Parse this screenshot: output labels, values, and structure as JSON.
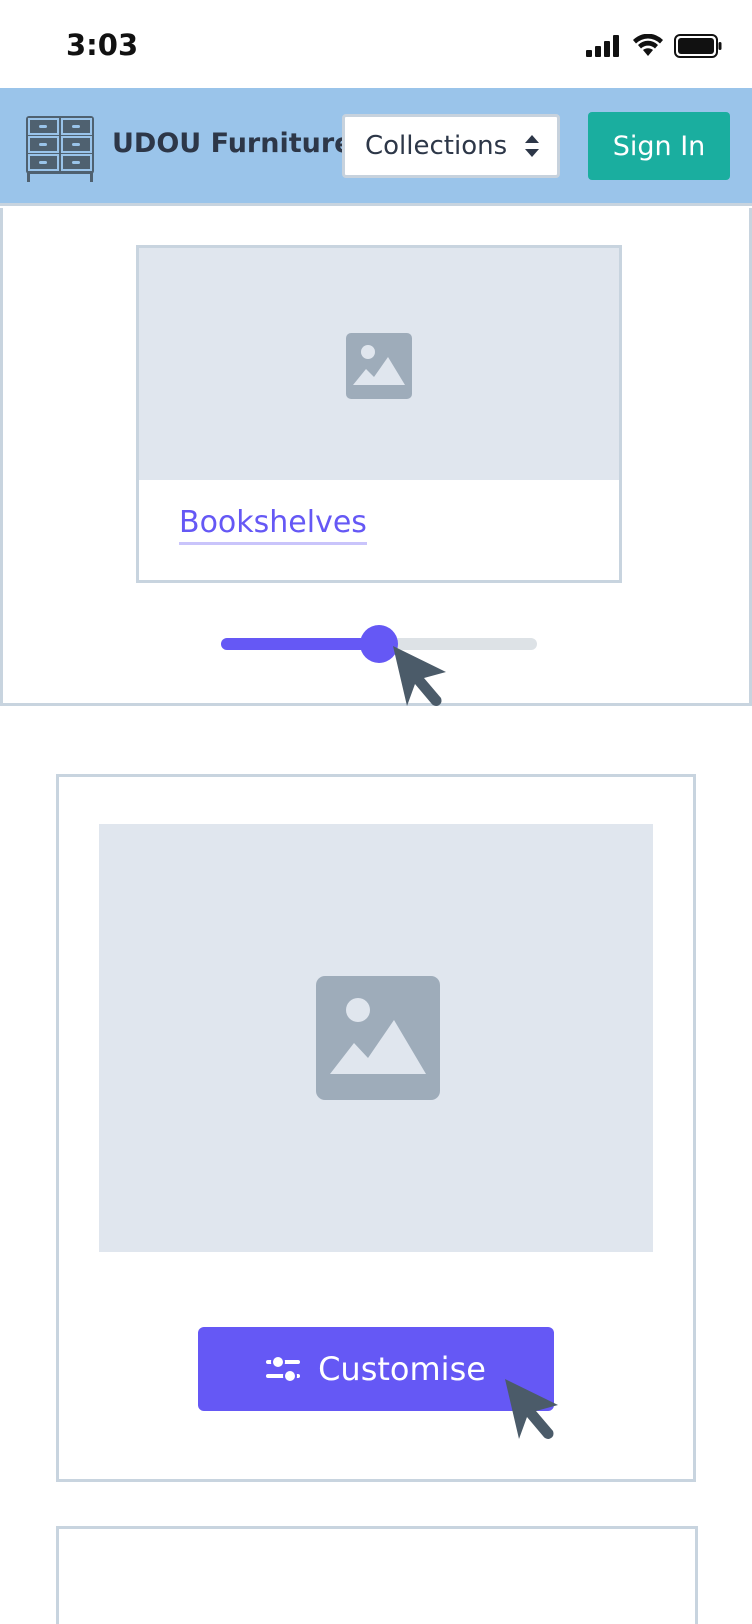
{
  "status_bar": {
    "time": "3:03",
    "icons": [
      "signal-icon",
      "wifi-icon",
      "battery-icon"
    ]
  },
  "header": {
    "brand": "UDOU Furniture",
    "logo_icon": "drawer-cabinet-icon",
    "collections_select": {
      "selected": "Collections"
    },
    "sign_in_label": "Sign In"
  },
  "section1": {
    "card": {
      "image_icon": "image-placeholder-icon",
      "link_label": "Bookshelves"
    },
    "slider": {
      "value": 0.5
    }
  },
  "section2": {
    "image_icon": "image-placeholder-icon",
    "customise_label": "Customise",
    "customise_icon": "sliders-icon"
  },
  "colors": {
    "header_bg": "#9ac4ea",
    "accent": "#6558f5",
    "sign_in": "#1aae9f",
    "placeholder": "#e0e6ee",
    "border": "#c8d4df"
  }
}
